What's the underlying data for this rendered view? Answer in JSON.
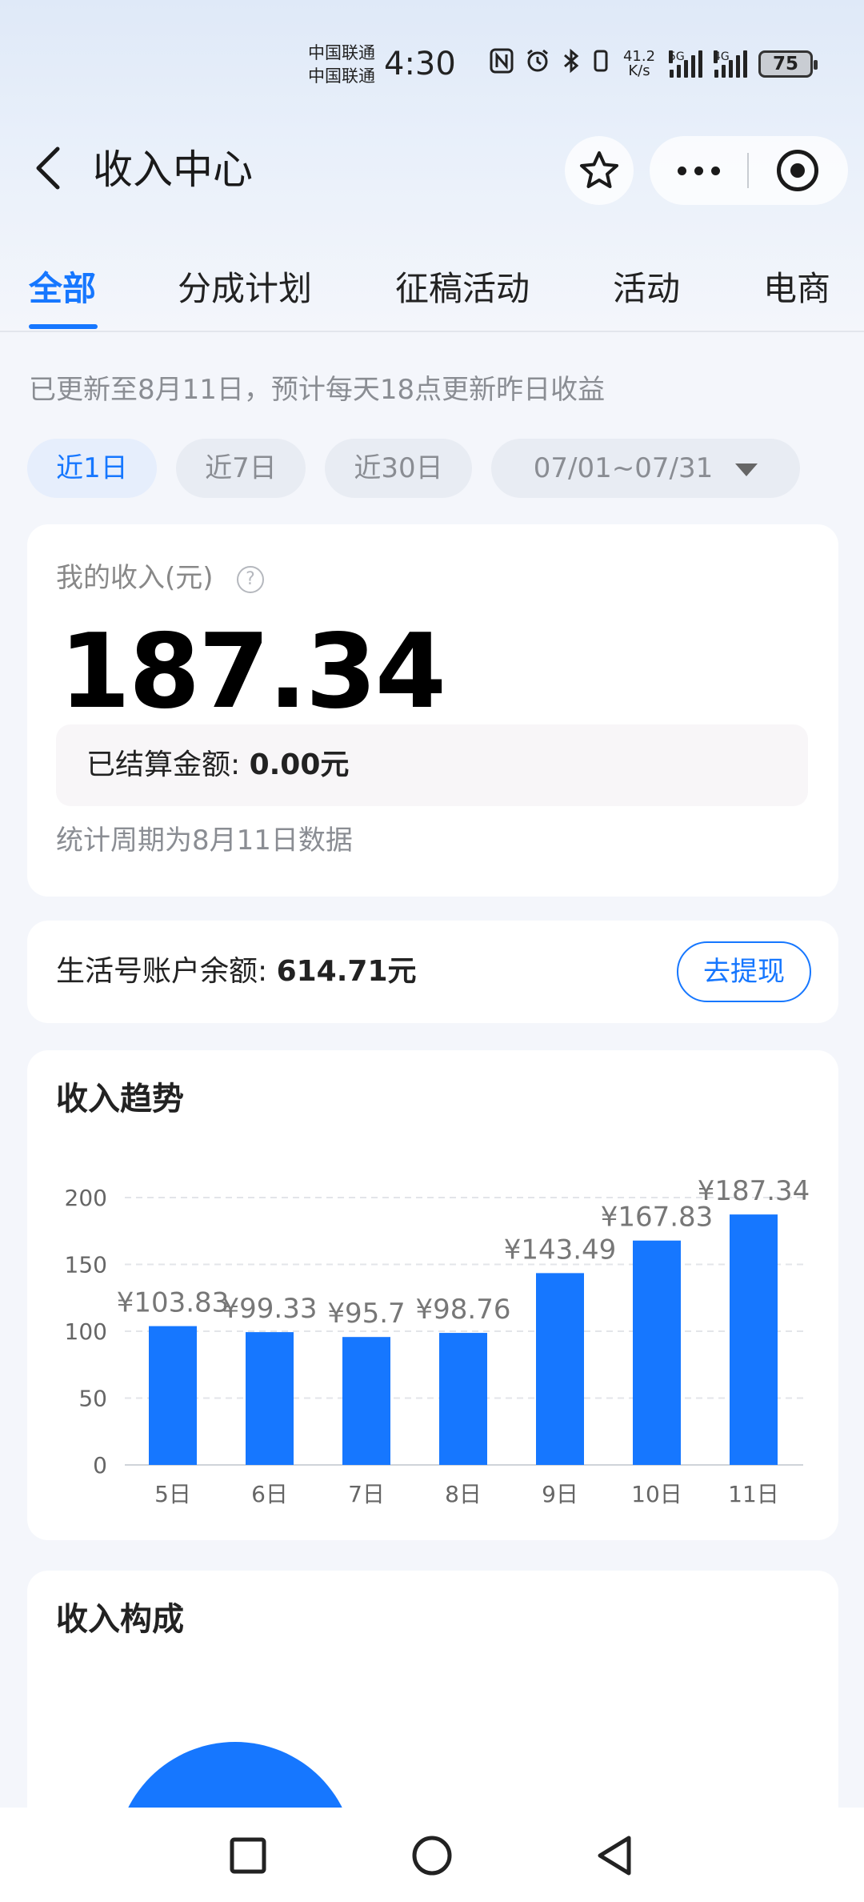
{
  "status_bar": {
    "carrier1": "中国联通",
    "carrier2": "中国联通",
    "time": "4:30",
    "net_speed_value": "41.2",
    "net_speed_unit": "K/s",
    "sig1_label": "5G",
    "sig2_label": "4G",
    "battery": "75",
    "icons": [
      "nfc-icon",
      "alarm-icon",
      "bluetooth-icon",
      "vibrate-icon",
      "signal-icon",
      "signal-icon",
      "battery-icon"
    ]
  },
  "header": {
    "back_icon": "back-arrow-icon",
    "title": "收入中心",
    "favorite_icon": "star-icon",
    "more_icon": "more-dots-icon",
    "close_icon": "target-icon"
  },
  "tabs": [
    {
      "label": "全部",
      "active": true
    },
    {
      "label": "分成计划",
      "active": false
    },
    {
      "label": "征稿活动",
      "active": false
    },
    {
      "label": "活动",
      "active": false
    },
    {
      "label": "电商",
      "active": false
    }
  ],
  "update_note": "已更新至8月11日，预计每天18点更新昨日收益",
  "filters": {
    "chips": [
      "近1日",
      "近7日",
      "近30日"
    ],
    "active_index": 0,
    "date_range": "07/01~07/31"
  },
  "income": {
    "label": "我的收入(元)",
    "help_icon": "?",
    "amount": "187.34",
    "settled_label": "已结算金额: ",
    "settled_value": "0.00元",
    "period_note": "统计周期为8月11日数据"
  },
  "balance": {
    "label": "生活号账户余额: ",
    "value": "614.71元",
    "withdraw_label": "去提现"
  },
  "trend": {
    "title": "收入趋势"
  },
  "chart_data": {
    "type": "bar",
    "categories": [
      "5日",
      "6日",
      "7日",
      "8日",
      "9日",
      "10日",
      "11日"
    ],
    "values": [
      103.83,
      99.33,
      95.7,
      98.76,
      143.49,
      167.83,
      187.34
    ],
    "data_labels": [
      "¥103.83",
      "¥99.33",
      "¥95.7",
      "¥98.76",
      "¥143.49",
      "¥167.83",
      "¥187.34"
    ],
    "yticks": [
      0,
      50,
      100,
      150,
      200
    ],
    "ylim": [
      0,
      200
    ],
    "grid": true,
    "bar_color": "#1677ff",
    "title": "",
    "xlabel": "",
    "ylabel": ""
  },
  "composition": {
    "title": "收入构成"
  },
  "nav": {
    "icons": [
      "recent-apps-icon",
      "home-icon",
      "back-icon"
    ]
  },
  "colors": {
    "accent": "#1677ff",
    "muted_text": "#8a8d93"
  }
}
